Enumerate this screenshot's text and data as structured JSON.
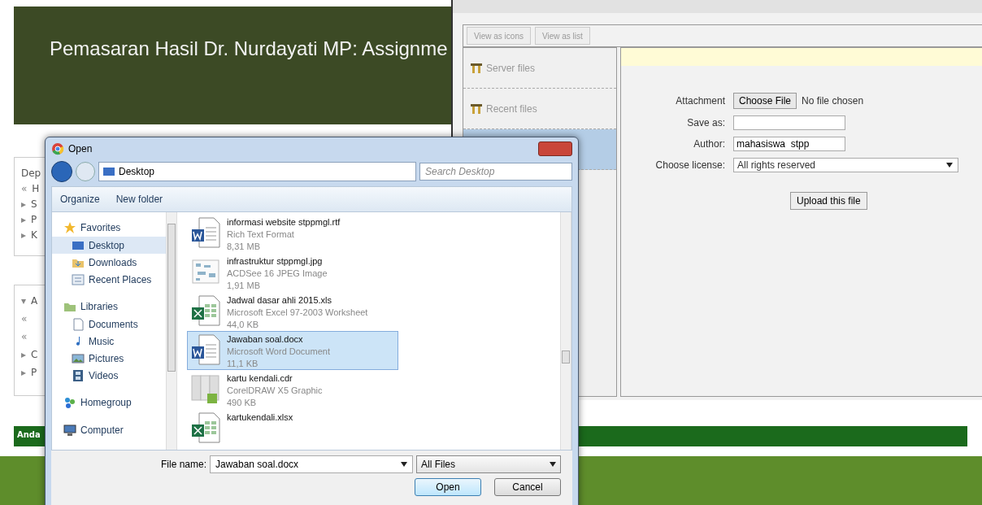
{
  "page": {
    "course_title": "Pemasaran Hasil Dr. Nurdayati MP: Assignme",
    "block_1": {
      "heading": "Dep",
      "items": [
        {
          "marker": "«",
          "text": "H"
        },
        {
          "marker": "▸",
          "text": "S"
        },
        {
          "marker": "▸",
          "text": "P"
        },
        {
          "marker": "▸",
          "text": "K"
        }
      ]
    },
    "block_2": {
      "items": [
        {
          "marker": "▾",
          "text": "A"
        },
        {
          "marker": "«"
        },
        {
          "marker": "«"
        },
        {
          "marker": "▸",
          "text": "C"
        },
        {
          "marker": "▸",
          "text": "P"
        }
      ]
    },
    "footer_bar": "Anda"
  },
  "file_picker": {
    "view_buttons": [
      {
        "label": "View as icons"
      },
      {
        "label": "View as list"
      }
    ],
    "repositories": [
      {
        "label": "Server files",
        "selected": false
      },
      {
        "label": "Recent files",
        "selected": false
      },
      {
        "selected": true
      }
    ],
    "form": {
      "attachment_label": "Attachment",
      "choose_file_button": "Choose File",
      "no_file_text": "No file chosen",
      "save_as_label": "Save as:",
      "author_label": "Author:",
      "author_value": "mahasiswa  stpp",
      "license_label": "Choose license:",
      "license_value": "All rights reserved",
      "upload_button": "Upload this file"
    }
  },
  "dialog": {
    "title": "Open",
    "path": "Desktop",
    "search_placeholder": "Search Desktop",
    "toolbar": [
      "Organize",
      "New folder"
    ],
    "nav": [
      {
        "label": "Favorites",
        "kind": "star",
        "selected": false,
        "children": [
          {
            "label": "Desktop",
            "kind": "desktop",
            "selected": true
          },
          {
            "label": "Downloads",
            "kind": "downloads",
            "selected": false
          },
          {
            "label": "Recent Places",
            "kind": "recent",
            "selected": false
          }
        ]
      },
      {
        "label": "Libraries",
        "kind": "library",
        "selected": false,
        "children": [
          {
            "label": "Documents",
            "kind": "document",
            "selected": false
          },
          {
            "label": "Music",
            "kind": "music",
            "selected": false
          },
          {
            "label": "Pictures",
            "kind": "pictures",
            "selected": false
          },
          {
            "label": "Videos",
            "kind": "videos",
            "selected": false
          }
        ]
      },
      {
        "label": "Homegroup",
        "kind": "homegroup",
        "selected": false
      },
      {
        "label": "Computer",
        "kind": "computer",
        "selected": false
      }
    ],
    "files": [
      {
        "name": "informasi website stppmgl.rtf",
        "type": "Rich Text Format",
        "size": "8,31 MB",
        "kind": "word",
        "selected": false
      },
      {
        "name": "infrastruktur stppmgl.jpg",
        "type": "ACDSee 16 JPEG Image",
        "size": "1,91 MB",
        "kind": "image",
        "selected": false
      },
      {
        "name": "Jadwal dasar ahli 2015.xls",
        "type": "Microsoft Excel 97-2003 Worksheet",
        "size": "44,0 KB",
        "kind": "excel",
        "selected": false
      },
      {
        "name": "Jawaban soal.docx",
        "type": "Microsoft Word Document",
        "size": "11,1 KB",
        "kind": "word",
        "selected": true
      },
      {
        "name": "kartu kendali.cdr",
        "type": "CorelDRAW X5 Graphic",
        "size": "490 KB",
        "kind": "corel",
        "selected": false
      },
      {
        "name": "kartukendali.xlsx",
        "kind": "excel",
        "selected": false
      }
    ],
    "file_name_label": "File name:",
    "file_name_value": "Jawaban soal.docx",
    "filter": "All Files",
    "buttons": [
      "Open",
      "Cancel"
    ]
  }
}
